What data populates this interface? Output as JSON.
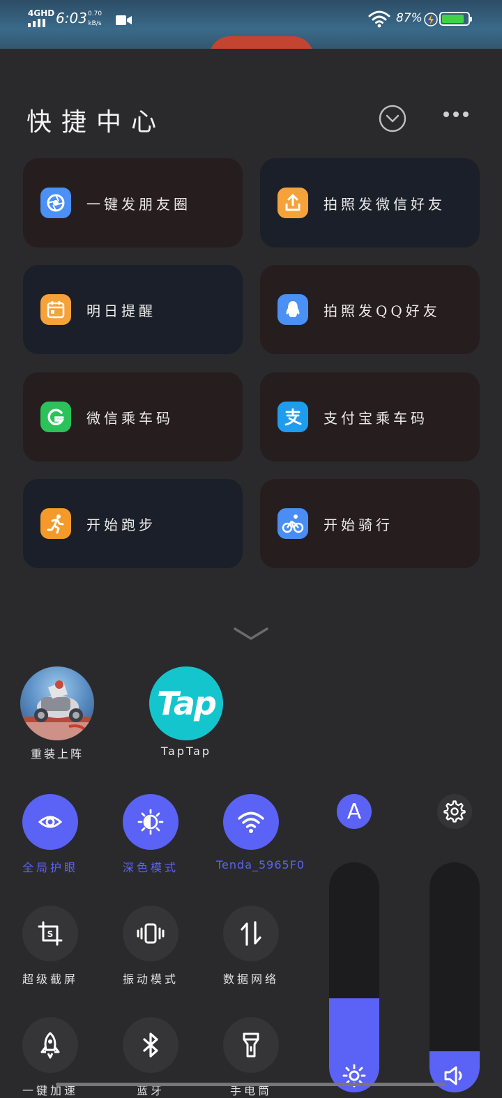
{
  "status_bar": {
    "network": "4GHD",
    "time": "6:03",
    "speed_value": "0.70",
    "speed_unit": "kB/s",
    "battery_pct": "87%",
    "battery_level": 0.87
  },
  "header": {
    "title": "快捷中心"
  },
  "shortcuts": [
    {
      "label": "一键发朋友圈",
      "icon": "camera-shutter-icon",
      "color": "#4a90f5"
    },
    {
      "label": "拍照发微信好友",
      "icon": "share-upload-icon",
      "color": "#f5a23a"
    },
    {
      "label": "明日提醒",
      "icon": "calendar-icon",
      "color": "#f5a23a"
    },
    {
      "label": "拍照发QQ好友",
      "icon": "qq-penguin-icon",
      "color": "#4a90f5"
    },
    {
      "label": "微信乘车码",
      "icon": "wechat-pay-icon",
      "color": "#2bc25a"
    },
    {
      "label": "支付宝乘车码",
      "icon": "alipay-icon",
      "color": "#1e9df0"
    },
    {
      "label": "开始跑步",
      "icon": "running-icon",
      "color": "#f59a2a"
    },
    {
      "label": "开始骑行",
      "icon": "cycling-icon",
      "color": "#4a8ef5"
    }
  ],
  "recent_apps": [
    {
      "name": "重装上阵"
    },
    {
      "name": "TapTap",
      "logo_text": "Tap"
    }
  ],
  "toggles": [
    {
      "label": "全局护眼",
      "state": "on",
      "icon": "eye-icon"
    },
    {
      "label": "深色模式",
      "state": "on",
      "icon": "dark-mode-icon"
    },
    {
      "label": "Tenda_5965F0",
      "state": "on",
      "icon": "wifi-icon"
    },
    {
      "label": "超级截屏",
      "state": "off",
      "icon": "screenshot-icon"
    },
    {
      "label": "振动模式",
      "state": "off",
      "icon": "vibrate-icon"
    },
    {
      "label": "数据网络",
      "state": "off",
      "icon": "mobile-data-icon"
    },
    {
      "label": "一键加速",
      "state": "off",
      "icon": "rocket-icon"
    },
    {
      "label": "蓝牙",
      "state": "off",
      "icon": "bluetooth-icon"
    },
    {
      "label": "手电筒",
      "state": "off",
      "icon": "flashlight-icon"
    }
  ],
  "auto_brightness_glyph": "A",
  "sliders": {
    "brightness_level": 0.41,
    "volume_level": 0.18
  },
  "colors": {
    "accent": "#5b62f6",
    "background": "#2a2a2c",
    "card_warm": "#261d1e",
    "card_cool": "#1b1f29"
  }
}
